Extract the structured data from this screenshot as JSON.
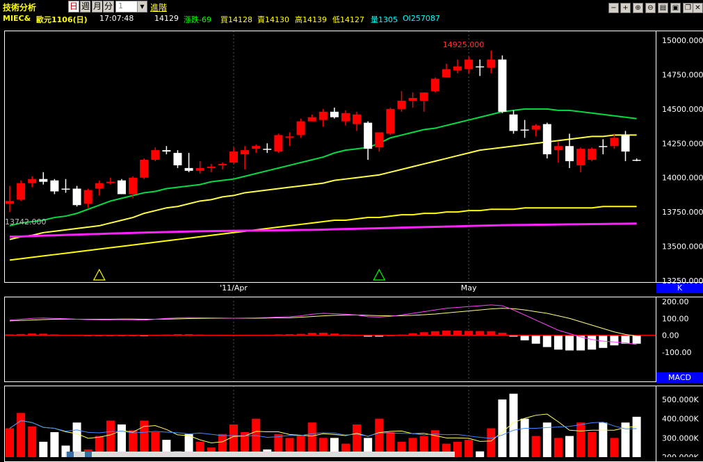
{
  "header": {
    "title": "技術分析",
    "periods": [
      "日",
      "週",
      "月",
      "分"
    ],
    "period_select_value": "1",
    "advanced_label": "進階"
  },
  "toolbar": {
    "icons": [
      "minus-icon",
      "plus-icon",
      "zoom-in-icon",
      "zoom-out-icon",
      "print-icon",
      "save-icon",
      "restore-icon",
      "close-icon"
    ],
    "glyphs": [
      "−",
      "+",
      "⊕",
      "⊖",
      "▤",
      "▣",
      "❐",
      "✕"
    ]
  },
  "quote": {
    "symbol": "MIEC&",
    "contract": "歐元1106(日)",
    "time": "17:07:48",
    "last": "14129",
    "change": "漲跌-69",
    "bid": "買14128",
    "ask": "賣14130",
    "high": "高14139",
    "low": "低14127",
    "volume": "量1305",
    "open_interest": "OI257087",
    "colors": {
      "yellow": "#ffff00",
      "white": "#ffffff",
      "cyan": "#00ffff",
      "green": "#00ff00"
    }
  },
  "chart_data": [
    {
      "type": "candlestick",
      "panel_label": "K",
      "ylim": [
        13250,
        15000
      ],
      "yticks": [
        "15000.000",
        "14750.000",
        "14500.000",
        "14250.000",
        "14000.000",
        "13750.000",
        "13500.000",
        "13250.000"
      ],
      "xticks": [
        {
          "label": "'11/Apr",
          "index": 20
        },
        {
          "label": "May",
          "index": 41
        }
      ],
      "annotations": {
        "high": "14925.000",
        "low": "13742.000"
      },
      "signal_markers": [
        {
          "index": 8,
          "color": "#ffff00"
        },
        {
          "index": 33,
          "color": "#00ff00"
        }
      ],
      "candles": [
        [
          13810,
          13940,
          13750,
          13830
        ],
        [
          13840,
          13980,
          13830,
          13960
        ],
        [
          13960,
          14010,
          13930,
          13990
        ],
        [
          13990,
          14040,
          13950,
          13970
        ],
        [
          13980,
          13990,
          13880,
          13900
        ],
        [
          13920,
          13990,
          13890,
          13920
        ],
        [
          13920,
          13940,
          13790,
          13800
        ],
        [
          13810,
          13920,
          13780,
          13910
        ],
        [
          13920,
          13980,
          13870,
          13960
        ],
        [
          13960,
          14000,
          13950,
          13970
        ],
        [
          13980,
          13990,
          13880,
          13880
        ],
        [
          13880,
          14010,
          13850,
          14000
        ],
        [
          14000,
          14140,
          13990,
          14130
        ],
        [
          14130,
          14220,
          14120,
          14200
        ],
        [
          14200,
          14230,
          14170,
          14190
        ],
        [
          14180,
          14200,
          14070,
          14090
        ],
        [
          14070,
          14180,
          14040,
          14050
        ],
        [
          14050,
          14120,
          14030,
          14070
        ],
        [
          14070,
          14100,
          14040,
          14080
        ],
        [
          14090,
          14110,
          14060,
          14100
        ],
        [
          14110,
          14220,
          14100,
          14190
        ],
        [
          14170,
          14230,
          14060,
          14200
        ],
        [
          14210,
          14240,
          14180,
          14230
        ],
        [
          14210,
          14250,
          14180,
          14210
        ],
        [
          14190,
          14320,
          14180,
          14310
        ],
        [
          14290,
          14330,
          14230,
          14300
        ],
        [
          14310,
          14430,
          14290,
          14410
        ],
        [
          14410,
          14460,
          14410,
          14440
        ],
        [
          14420,
          14500,
          14370,
          14480
        ],
        [
          14480,
          14510,
          14430,
          14440
        ],
        [
          14410,
          14490,
          14380,
          14470
        ],
        [
          14390,
          14480,
          14340,
          14460
        ],
        [
          14400,
          14410,
          14130,
          14210
        ],
        [
          14220,
          14310,
          14190,
          14330
        ],
        [
          14320,
          14510,
          14310,
          14500
        ],
        [
          14500,
          14630,
          14480,
          14560
        ],
        [
          14560,
          14620,
          14510,
          14580
        ],
        [
          14560,
          14610,
          14480,
          14620
        ],
        [
          14630,
          14730,
          14620,
          14720
        ],
        [
          14730,
          14830,
          14730,
          14790
        ],
        [
          14780,
          14860,
          14760,
          14810
        ],
        [
          14790,
          14880,
          14760,
          14860
        ],
        [
          14810,
          14860,
          14740,
          14810
        ],
        [
          14800,
          14925,
          14760,
          14860
        ],
        [
          14860,
          14890,
          14470,
          14480
        ],
        [
          14460,
          14490,
          14320,
          14340
        ],
        [
          14350,
          14420,
          14290,
          14350
        ],
        [
          14350,
          14390,
          14300,
          14380
        ],
        [
          14390,
          14400,
          14140,
          14170
        ],
        [
          14200,
          14260,
          14110,
          14230
        ],
        [
          14230,
          14320,
          14070,
          14120
        ],
        [
          14090,
          14220,
          14040,
          14210
        ],
        [
          14130,
          14220,
          14120,
          14210
        ],
        [
          14230,
          14280,
          14170,
          14230
        ],
        [
          14230,
          14320,
          14210,
          14290
        ],
        [
          14310,
          14340,
          14120,
          14190
        ],
        [
          14130,
          14140,
          14120,
          14130
        ]
      ],
      "overlays": [
        {
          "color": "#00dd44",
          "values": [
            13650,
            13670,
            13680,
            13690,
            13710,
            13720,
            13740,
            13770,
            13800,
            13830,
            13850,
            13870,
            13890,
            13900,
            13920,
            13930,
            13940,
            13950,
            13970,
            13980,
            13990,
            14010,
            14030,
            14050,
            14070,
            14090,
            14110,
            14130,
            14150,
            14180,
            14200,
            14210,
            14220,
            14250,
            14290,
            14310,
            14330,
            14350,
            14360,
            14380,
            14400,
            14420,
            14440,
            14460,
            14480,
            14490,
            14500,
            14500,
            14500,
            14490,
            14490,
            14480,
            14470,
            14460,
            14450,
            14440,
            14430
          ]
        },
        {
          "color": "#ffff44",
          "values": [
            13550,
            13570,
            13580,
            13600,
            13610,
            13620,
            13630,
            13640,
            13650,
            13670,
            13690,
            13710,
            13740,
            13760,
            13780,
            13790,
            13810,
            13830,
            13840,
            13860,
            13870,
            13890,
            13900,
            13910,
            13920,
            13930,
            13940,
            13950,
            13960,
            13980,
            13990,
            14000,
            14010,
            14020,
            14040,
            14060,
            14080,
            14100,
            14120,
            14140,
            14160,
            14180,
            14200,
            14210,
            14220,
            14230,
            14240,
            14250,
            14260,
            14270,
            14280,
            14290,
            14300,
            14300,
            14310,
            14310,
            14310
          ]
        },
        {
          "color": "#ffff00",
          "values": [
            13400,
            13410,
            13420,
            13430,
            13440,
            13450,
            13460,
            13470,
            13480,
            13490,
            13500,
            13510,
            13520,
            13530,
            13540,
            13550,
            13560,
            13570,
            13580,
            13590,
            13600,
            13610,
            13620,
            13630,
            13640,
            13650,
            13660,
            13670,
            13680,
            13690,
            13690,
            13700,
            13710,
            13710,
            13720,
            13730,
            13730,
            13740,
            13740,
            13750,
            13750,
            13760,
            13760,
            13770,
            13770,
            13770,
            13780,
            13780,
            13780,
            13780,
            13780,
            13780,
            13780,
            13790,
            13790,
            13790,
            13790
          ]
        },
        {
          "color": "#ff22ff",
          "values": [
            13570,
            13572,
            13575,
            13578,
            13580,
            13583,
            13585,
            13588,
            13590,
            13593,
            13595,
            13598,
            13600,
            13602,
            13604,
            13606,
            13608,
            13610,
            13611,
            13612,
            13613,
            13614,
            13615,
            13616,
            13617,
            13618,
            13619,
            13620,
            13622,
            13624,
            13626,
            13628,
            13630,
            13632,
            13634,
            13636,
            13638,
            13640,
            13642,
            13644,
            13646,
            13648,
            13650,
            13652,
            13654,
            13655,
            13656,
            13657,
            13658,
            13659,
            13660,
            13661,
            13662,
            13663,
            13664,
            13665,
            13666
          ]
        }
      ]
    },
    {
      "type": "macd",
      "panel_label": "MACD",
      "ylim": [
        -150,
        200
      ],
      "yticks": [
        "200.00",
        "100.00",
        "0.00",
        "-100.00"
      ],
      "dif_color": "#ff44ff",
      "dem_color": "#ffff88",
      "dif": [
        90,
        95,
        100,
        102,
        100,
        98,
        95,
        93,
        92,
        92,
        93,
        92,
        90,
        95,
        100,
        103,
        105,
        104,
        103,
        102,
        101,
        102,
        103,
        105,
        108,
        110,
        115,
        125,
        130,
        128,
        125,
        120,
        110,
        108,
        112,
        120,
        130,
        140,
        150,
        160,
        165,
        170,
        175,
        180,
        175,
        150,
        120,
        90,
        60,
        30,
        10,
        -10,
        -25,
        -35,
        -40,
        -45,
        -55
      ],
      "dem": [
        85,
        88,
        90,
        93,
        95,
        96,
        95,
        95,
        95,
        95,
        96,
        96,
        95,
        95,
        96,
        97,
        99,
        100,
        101,
        101,
        101,
        101,
        101,
        102,
        103,
        104,
        107,
        111,
        115,
        118,
        120,
        120,
        118,
        116,
        115,
        116,
        118,
        122,
        126,
        132,
        138,
        144,
        150,
        156,
        160,
        158,
        150,
        140,
        130,
        115,
        100,
        80,
        60,
        40,
        20,
        5,
        -5
      ],
      "hist": [
        5,
        7,
        10,
        9,
        5,
        2,
        0,
        -2,
        -3,
        -3,
        -3,
        -4,
        -5,
        0,
        4,
        6,
        6,
        4,
        2,
        1,
        0,
        1,
        2,
        3,
        5,
        6,
        8,
        14,
        15,
        10,
        5,
        0,
        -8,
        -8,
        -3,
        4,
        12,
        18,
        24,
        28,
        27,
        26,
        25,
        24,
        15,
        -8,
        -30,
        -50,
        -70,
        -85,
        -90,
        -90,
        -85,
        -75,
        -60,
        -50,
        -50
      ]
    },
    {
      "type": "bar",
      "panel_label": "",
      "ylim": [
        200000,
        550000
      ],
      "yticks": [
        "500.000K",
        "400.000K",
        "300.000K",
        "200.000K"
      ],
      "up_color": "#ff0000",
      "down_color": "#ffffff",
      "values": [
        350000,
        430000,
        360000,
        280000,
        330000,
        260000,
        380000,
        240000,
        310000,
        390000,
        370000,
        340000,
        390000,
        330000,
        290000,
        230000,
        320000,
        280000,
        250000,
        320000,
        370000,
        330000,
        400000,
        240000,
        320000,
        300000,
        310000,
        380000,
        300000,
        300000,
        270000,
        370000,
        300000,
        400000,
        330000,
        280000,
        300000,
        310000,
        340000,
        270000,
        280000,
        290000,
        230000,
        350000,
        500000,
        530000,
        400000,
        310000,
        380000,
        300000,
        310000,
        380000,
        330000,
        380000,
        300000,
        380000,
        410000
      ]
    }
  ]
}
